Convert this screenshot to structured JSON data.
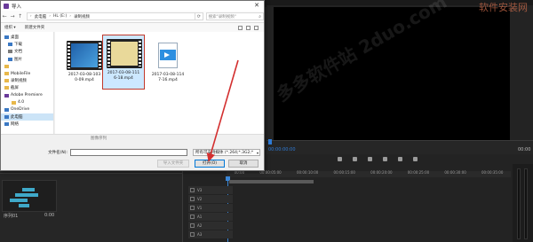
{
  "dialog": {
    "title": "导入",
    "close": "✕"
  },
  "nav": {
    "back": "←",
    "forward": "→",
    "up": "↑",
    "breadcrumb": [
      "此电脑",
      "HL (E:)",
      "录制视频"
    ],
    "refresh": "⟳",
    "search_placeholder": "搜索\"录制视频\""
  },
  "toolbar": {
    "organize": "组织 ▾",
    "new_folder": "新建文件夹"
  },
  "sidebar": {
    "items": [
      {
        "label": "桌面",
        "icon": "desktop-icon",
        "color": "#3a78c3"
      },
      {
        "label": "下载",
        "icon": "download-icon",
        "color": "#3a78c3"
      },
      {
        "label": "文档",
        "icon": "document-icon",
        "color": "#7a7a7a"
      },
      {
        "label": "图片",
        "icon": "picture-icon",
        "color": "#3a78c3"
      },
      {
        "label": "",
        "icon": "folder-icon",
        "color": "#e8b84a"
      },
      {
        "label": "MobileFile",
        "icon": "folder-icon",
        "color": "#e8b84a"
      },
      {
        "label": "录制视频",
        "icon": "folder-icon",
        "color": "#e8b84a"
      },
      {
        "label": "截屏",
        "icon": "folder-icon",
        "color": "#e8b84a"
      },
      {
        "label": "Adobe Premiere",
        "icon": "premiere-icon",
        "color": "#6a3a9a"
      },
      {
        "label": "4.0",
        "icon": "folder-icon",
        "color": "#e8b84a"
      },
      {
        "label": "OneDrive",
        "icon": "cloud-icon",
        "color": "#3a78c3"
      },
      {
        "label": "此电脑",
        "icon": "computer-icon",
        "color": "#3a78c3",
        "selected": true
      },
      {
        "label": "网络",
        "icon": "network-icon",
        "color": "#3a78c3"
      }
    ]
  },
  "files": [
    {
      "name": "2017-03-08-103\n0-09.mp4",
      "kind": "video-blue"
    },
    {
      "name": "2017-03-08-111\n6-18.mp4",
      "kind": "video-yellow",
      "selected": true
    },
    {
      "name": "2017-03-08-114\n7-16.mp4",
      "kind": "video-doc"
    }
  ],
  "status": {
    "text": "图像序列"
  },
  "filename": {
    "label": "文件名(N):",
    "value": "",
    "type_filter": "所有可支持媒体 (*.264;*.3G2;*"
  },
  "buttons": {
    "import_folder": "导入文件夹",
    "open": "打开(O)",
    "cancel": "取消"
  },
  "premiere": {
    "watermark_top": "软件安装网",
    "watermark_mid": "多多软件站 2duo.com",
    "timecode_left": "00:00:00:00",
    "timecode_right": "00:00",
    "ruler": [
      "00:00",
      "00:00:05:00",
      "00:00:10:00",
      "00:00:15:00",
      "00:00:20:00",
      "00:00:25:00",
      "00:00:30:00",
      "00:00:35:00"
    ],
    "tracks": [
      "V3",
      "V2",
      "V1",
      "A1",
      "A2",
      "A3"
    ],
    "project_item": "序列01",
    "project_duration": "0:00"
  },
  "colors": {
    "accent_arrow": "#d32f2f",
    "selection_border": "#c0392b",
    "selection_bg": "#cce8ff",
    "premiere_blue": "#3a86d6"
  }
}
